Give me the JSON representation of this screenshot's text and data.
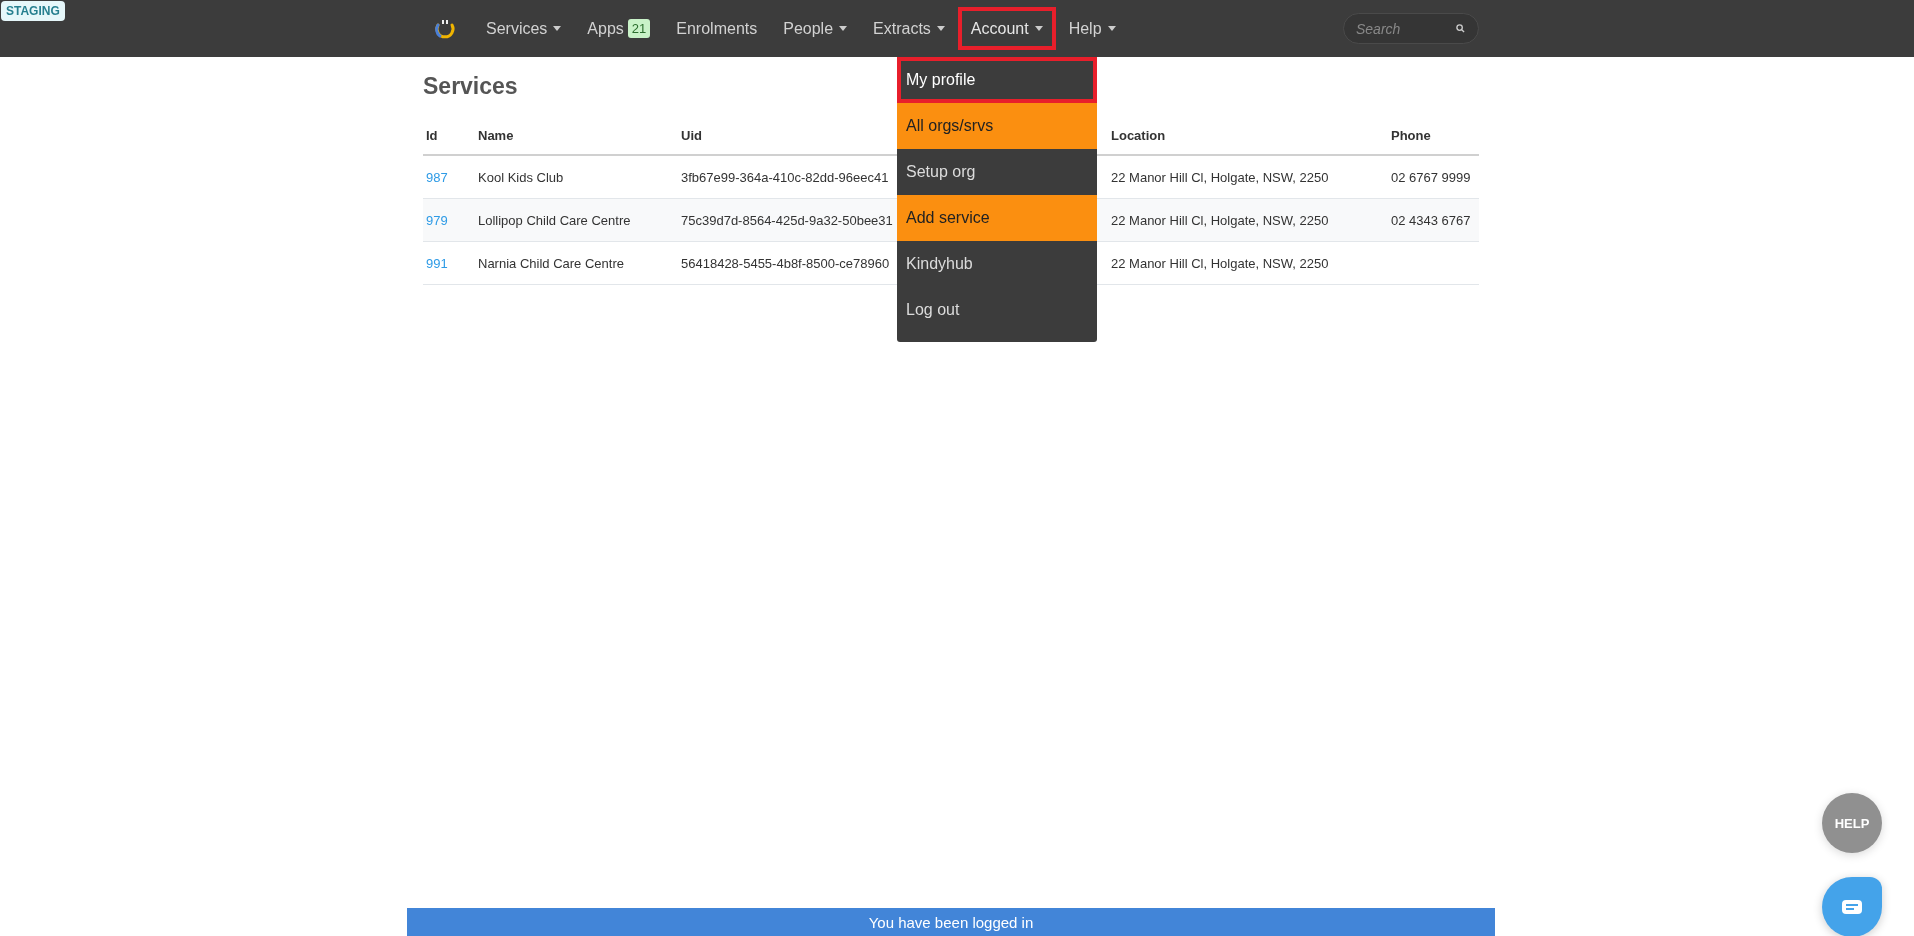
{
  "badge": "STAGING",
  "nav": {
    "items": [
      {
        "label": "Services",
        "caret": true,
        "annotated": false
      },
      {
        "label": "Apps",
        "caret": false,
        "count": "21",
        "annotated": false
      },
      {
        "label": "Enrolments",
        "caret": false,
        "annotated": false
      },
      {
        "label": "People",
        "caret": true,
        "annotated": false
      },
      {
        "label": "Extracts",
        "caret": true,
        "annotated": false
      },
      {
        "label": "Account",
        "caret": true,
        "annotated": true,
        "expanded": true
      },
      {
        "label": "Help",
        "caret": true,
        "annotated": false
      }
    ],
    "search": {
      "placeholder": "Search"
    }
  },
  "menu": [
    {
      "label": "My profile",
      "highlighted": false,
      "annotated": true
    },
    {
      "label": "All orgs/srvs",
      "highlighted": true,
      "annotated": false
    },
    {
      "label": "Setup org",
      "highlighted": false,
      "annotated": false
    },
    {
      "label": "Add service",
      "highlighted": true,
      "annotated": false
    },
    {
      "label": "Kindyhub",
      "highlighted": false,
      "annotated": false
    },
    {
      "label": "Log out",
      "highlighted": false,
      "annotated": false
    }
  ],
  "page": {
    "title": "Services"
  },
  "table": {
    "columns": [
      "Id",
      "Name",
      "Uid",
      "Location",
      "Phone"
    ],
    "rows": [
      {
        "id": "987",
        "name": "Kool Kids Club",
        "uid": "3fb67e99-364a-410c-82dd-96eec41",
        "location": "22 Manor Hill Cl, Holgate, NSW, 2250",
        "phone": "02 6767 9999"
      },
      {
        "id": "979",
        "name": "Lollipop Child Care Centre",
        "uid": "75c39d7d-8564-425d-9a32-50bee31",
        "location": "22 Manor Hill Cl, Holgate, NSW, 2250",
        "phone": "02 4343 6767"
      },
      {
        "id": "991",
        "name": "Narnia Child Care Centre",
        "uid": "56418428-5455-4b8f-8500-ce78960",
        "location": "22 Manor Hill Cl, Holgate, NSW, 2250"
      }
    ]
  },
  "help_button": "HELP",
  "toast": "You have been logged in"
}
